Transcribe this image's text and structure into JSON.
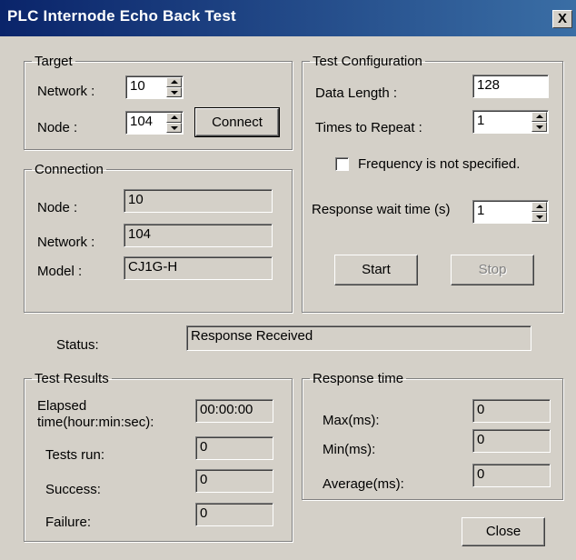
{
  "window": {
    "title": "PLC Internode Echo Back Test",
    "close_glyph": "X"
  },
  "target": {
    "legend": "Target",
    "network_label": "Network :",
    "network_value": "10",
    "node_label": "Node :",
    "node_value": "104",
    "connect_label": "Connect"
  },
  "connection": {
    "legend": "Connection",
    "node_label": "Node :",
    "node_value": "10",
    "network_label": "Network :",
    "network_value": "104",
    "model_label": "Model :",
    "model_value": "CJ1G-H"
  },
  "test_config": {
    "legend": "Test Configuration",
    "data_length_label": "Data Length :",
    "data_length_value": "128",
    "times_label": "Times to Repeat :",
    "times_value": "1",
    "frequency_label": "Frequency is not specified.",
    "frequency_checked": false,
    "wait_label": "Response wait time (s)",
    "wait_value": "1",
    "start_label": "Start",
    "stop_label": "Stop"
  },
  "status": {
    "label": "Status:",
    "value": "Response Received"
  },
  "results": {
    "legend": "Test Results",
    "elapsed_label_1": "Elapsed",
    "elapsed_label_2": "time(hour:min:sec):",
    "elapsed_value": "00:00:00",
    "tests_run_label": "Tests run:",
    "tests_run_value": "0",
    "success_label": "Success:",
    "success_value": "0",
    "failure_label": "Failure:",
    "failure_value": "0"
  },
  "response_time": {
    "legend": "Response time",
    "max_label": "Max(ms):",
    "max_value": "0",
    "min_label": "Min(ms):",
    "min_value": "0",
    "avg_label": "Average(ms):",
    "avg_value": "0"
  },
  "footer": {
    "close_label": "Close"
  }
}
